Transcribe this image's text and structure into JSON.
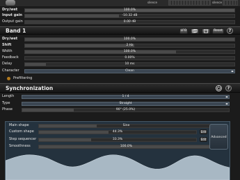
{
  "meter_labels": {
    "left": "silence",
    "right": "silence"
  },
  "global": {
    "drywet": {
      "label": "Dry/wet",
      "value": "100.0%",
      "fill": 1.0
    },
    "input_gain": {
      "label": "Input gain",
      "value": "-10.32 dB",
      "fill": 0.45
    },
    "output_gain": {
      "label": "Output gain",
      "value": "0.00 dB",
      "fill": 0.5
    }
  },
  "band": {
    "title": "Band 1",
    "buttons": {
      "lfo": "LFO",
      "copy": "copy-icon",
      "paste": "paste-icon",
      "reset": "Reset",
      "help": "?"
    },
    "params": [
      {
        "label": "Dry/wet",
        "value": "100.0%",
        "fill": 1.0,
        "bold": true
      },
      {
        "label": "Shift",
        "value": "2 Hz",
        "fill": 0.52,
        "bold": true
      },
      {
        "label": "Width",
        "value": "100.0%",
        "fill": 0.72,
        "bold": false
      },
      {
        "label": "Feedback",
        "value": "0.00%",
        "fill": 0.0,
        "bold": false
      },
      {
        "label": "Delay",
        "value": "10 ms",
        "fill": 0.1,
        "bold": false
      }
    ],
    "character": {
      "label": "Character",
      "value": "Clean"
    },
    "prefiltering": "Prefiltering"
  },
  "sync": {
    "title": "Synchronization",
    "length": {
      "label": "Length",
      "value": "1 / 4"
    },
    "type": {
      "label": "Type",
      "value": "Straight"
    },
    "phase": {
      "label": "Phase",
      "value": "90° (25.0%)",
      "fill": 0.25
    }
  },
  "shape": {
    "main_shape": {
      "label": "Main shape",
      "value": "Sine",
      "fill": 0.33
    },
    "custom_shape": {
      "label": "Custom shape",
      "value": "44.3%",
      "fill": 0.443,
      "edit": "Edit"
    },
    "step_sequencer": {
      "label": "Step sequencer",
      "value": "33.3%",
      "fill": 0.333,
      "edit": "Edit"
    },
    "smoothness": {
      "label": "Smoothness",
      "value": "100.0%",
      "fill": 1.0
    },
    "advanced": "Advanced"
  },
  "colors": {
    "accent": "#3f8ed8",
    "panel": "#24323e",
    "wave": "#a8b8c4"
  }
}
